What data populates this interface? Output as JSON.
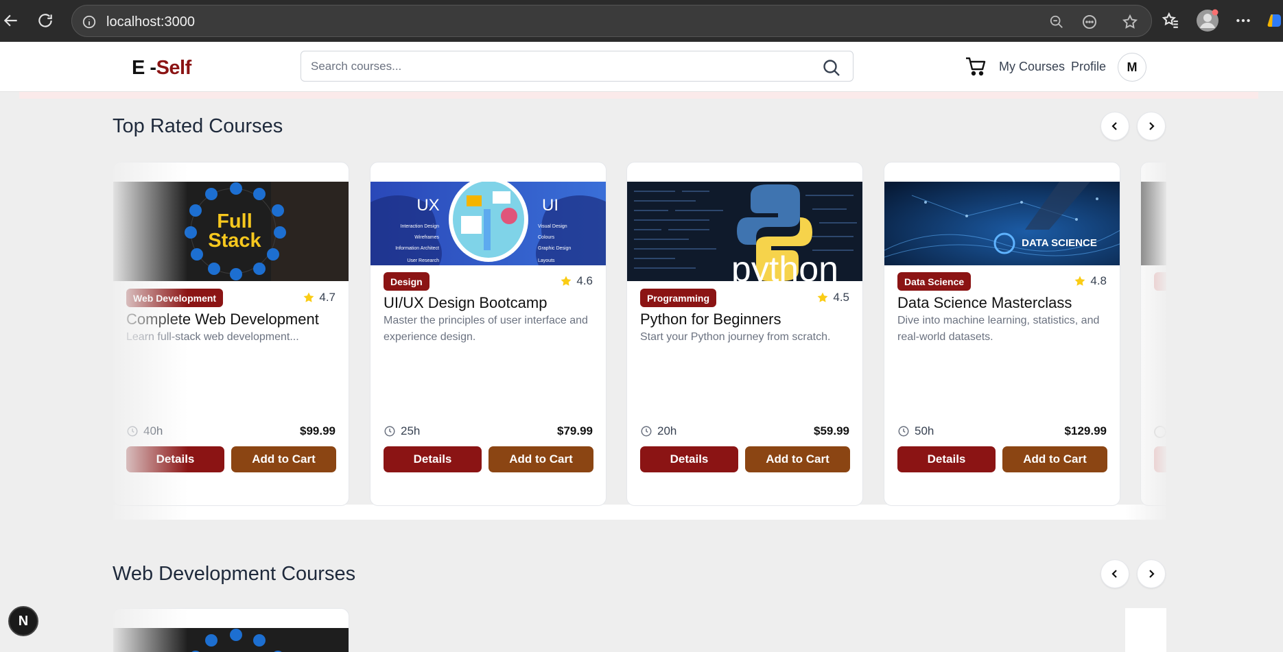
{
  "browser": {
    "url": "localhost:3000"
  },
  "header": {
    "logo_prefix": "E -",
    "logo_accent": "Self",
    "search_placeholder": "Search courses...",
    "nav": {
      "my_courses": "My Courses",
      "profile": "Profile"
    },
    "avatar_initial": "M",
    "icons": {
      "cart": "cart-icon",
      "search": "search-icon"
    }
  },
  "sections": [
    {
      "title": "Top Rated Courses",
      "courses": [
        {
          "category": "Web Development",
          "rating": "4.7",
          "title": "Complete Web Development",
          "description": "Learn full-stack web development...",
          "duration": "40h",
          "price": "$99.99",
          "details_label": "Details",
          "cart_label": "Add to Cart",
          "image_text_line1": "Full",
          "image_text_line2": "Stack"
        },
        {
          "category": "Design",
          "rating": "4.6",
          "title": "UI/UX Design Bootcamp",
          "description": "Master the principles of user interface and experience design.",
          "duration": "25h",
          "price": "$79.99",
          "details_label": "Details",
          "cart_label": "Add to Cart",
          "image_text_left": "UX",
          "image_text_right": "UI",
          "image_left_items": [
            "Interaction Design",
            "Wireframes",
            "Information Architect",
            "User Research"
          ],
          "image_right_items": [
            "Visual Design",
            "Colours",
            "Graphic Design",
            "Layouts"
          ]
        },
        {
          "category": "Programming",
          "rating": "4.5",
          "title": "Python for Beginners",
          "description": "Start your Python journey from scratch.",
          "duration": "20h",
          "price": "$59.99",
          "details_label": "Details",
          "cart_label": "Add to Cart",
          "image_text": "python"
        },
        {
          "category": "Data Science",
          "rating": "4.8",
          "title": "Data Science Masterclass",
          "description": "Dive into machine learning, statistics, and real-world datasets.",
          "duration": "50h",
          "price": "$129.99",
          "details_label": "Details",
          "cart_label": "Add to Cart",
          "image_text": "DATA SCIENCE"
        }
      ]
    },
    {
      "title": "Web Development Courses"
    }
  ],
  "colors": {
    "primary": "#8b1414",
    "secondary": "#8b4513",
    "star": "#facc15"
  },
  "next_badge": "N"
}
